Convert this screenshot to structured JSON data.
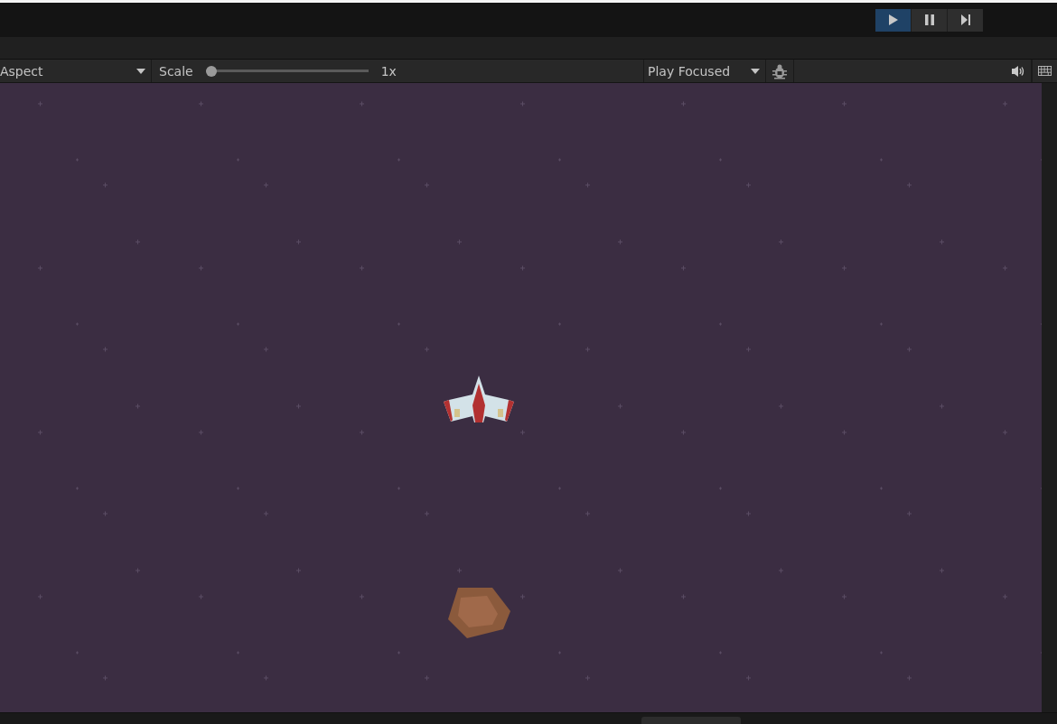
{
  "play_controls": [
    {
      "kind": "play",
      "selected": true
    },
    {
      "kind": "pause",
      "selected": false
    },
    {
      "kind": "step",
      "selected": false
    }
  ],
  "game_toolbar": {
    "aspect": "Aspect",
    "scale": {
      "label": "Scale",
      "level": 0.0,
      "reading": "1x"
    },
    "play_mode": "Play Focused"
  }
}
